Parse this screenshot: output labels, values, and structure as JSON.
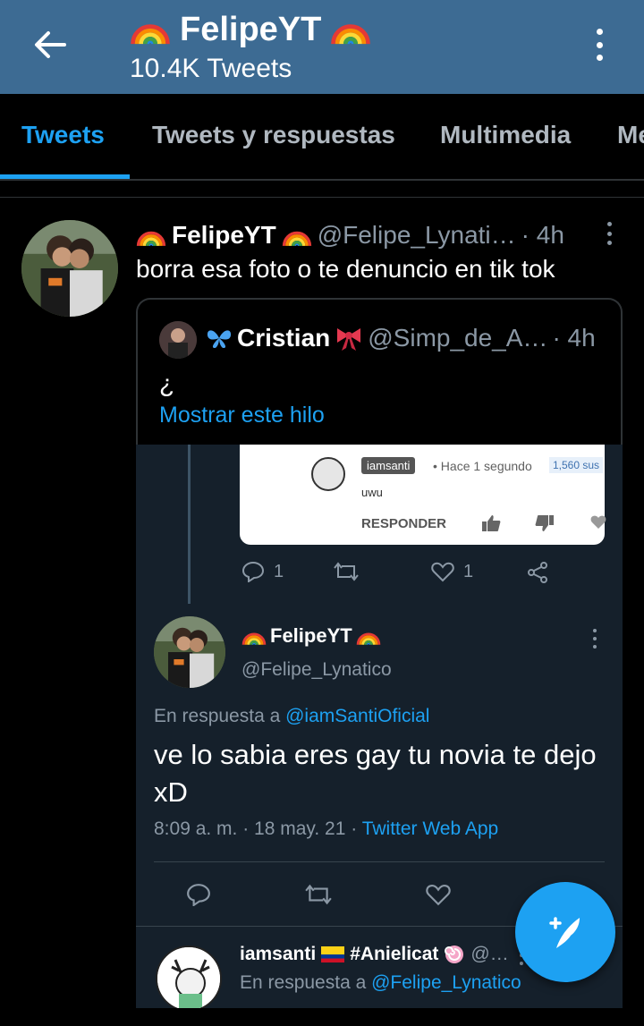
{
  "header": {
    "title": "FelipeYT",
    "subtitle": "10.4K Tweets"
  },
  "tabs": [
    {
      "label": "Tweets",
      "active": true
    },
    {
      "label": "Tweets y respuestas",
      "active": false
    },
    {
      "label": "Multimedia",
      "active": false
    },
    {
      "label": "Me",
      "active": false
    }
  ],
  "tweet": {
    "name": "FelipeYT",
    "handle": "@Felipe_Lynati…",
    "time": "· 4h",
    "text": "borra esa foto o te denuncio en tik tok",
    "quote": {
      "name": "Cristian",
      "handle": "@Simp_de_A…",
      "time": "· 4h",
      "text": "¿",
      "link": "Mostrar este hilo"
    }
  },
  "embedded": {
    "yt": {
      "name": "iamsanti",
      "time": "• Hace 1 segundo",
      "subs": "1,560 sus",
      "comment": "uwu",
      "reply": "RESPONDER"
    },
    "actions1": {
      "replies": "1",
      "likes": "1"
    },
    "reply_tweet": {
      "name": "FelipeYT",
      "handle": "@Felipe_Lynatico",
      "reply_prefix": "En respuesta a",
      "reply_mention": "@iamSantiOficial",
      "text": "ve lo sabia eres gay tu novia te dejo xD",
      "meta_time": "8:09 a. m. · 18 may. 21 ·",
      "meta_source": "Twitter Web App"
    },
    "next_tweet": {
      "name": "iamsanti",
      "tag": "#Anielicat",
      "handle": "@…",
      "reply_prefix": "En respuesta a",
      "reply_mention": "@Felipe_Lynatico"
    }
  },
  "colors": {
    "header_bg": "#3d6b93",
    "accent": "#1da1f2",
    "embedded_bg": "#15202b"
  }
}
